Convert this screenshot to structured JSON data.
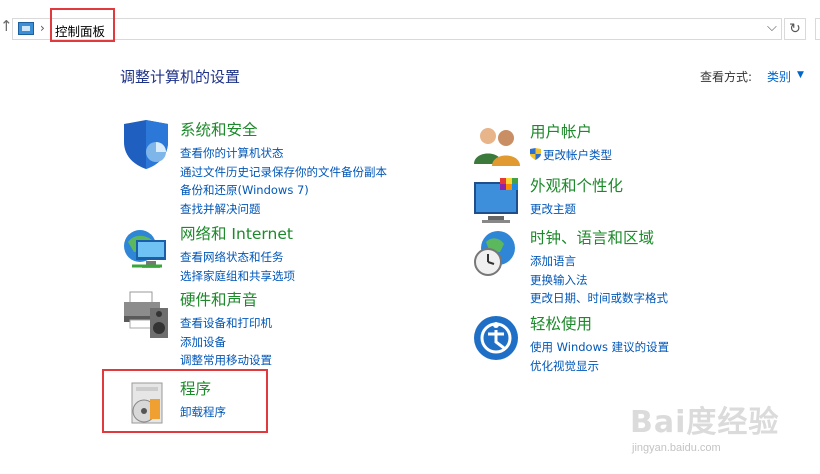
{
  "address_bar": {
    "crumb": "控制面板"
  },
  "header": {
    "title": "调整计算机的设置",
    "view_by_label": "查看方式:",
    "view_by_value": "类别"
  },
  "categories": [
    {
      "title": "系统和安全",
      "icon": "shield-icon",
      "links": [
        "查看你的计算机状态",
        "通过文件历史记录保存你的文件备份副本",
        "备份和还原(Windows 7)",
        "查找并解决问题"
      ]
    },
    {
      "title": "网络和 Internet",
      "icon": "network-globe-icon",
      "links": [
        "查看网络状态和任务",
        "选择家庭组和共享选项"
      ]
    },
    {
      "title": "硬件和声音",
      "icon": "printer-speaker-icon",
      "links": [
        "查看设备和打印机",
        "添加设备",
        "调整常用移动设置"
      ]
    },
    {
      "title": "程序",
      "icon": "programs-disc-icon",
      "links": [
        "卸载程序"
      ]
    },
    {
      "title": "用户帐户",
      "icon": "users-icon",
      "links": [
        "更改帐户类型"
      ]
    },
    {
      "title": "外观和个性化",
      "icon": "monitor-palette-icon",
      "links": [
        "更改主题"
      ]
    },
    {
      "title": "时钟、语言和区域",
      "icon": "clock-globe-icon",
      "links": [
        "添加语言",
        "更换输入法",
        "更改日期、时间或数字格式"
      ]
    },
    {
      "title": "轻松使用",
      "icon": "ease-of-access-icon",
      "links": [
        "使用 Windows 建议的设置",
        "优化视觉显示"
      ]
    }
  ],
  "watermark": {
    "text": "Bai度经验",
    "sub": "jingyan.baidu.com"
  },
  "colors": {
    "category_title": "#1c8a2a",
    "link": "#0057b8",
    "heading": "#1e3287",
    "highlight": "#e0393e"
  }
}
